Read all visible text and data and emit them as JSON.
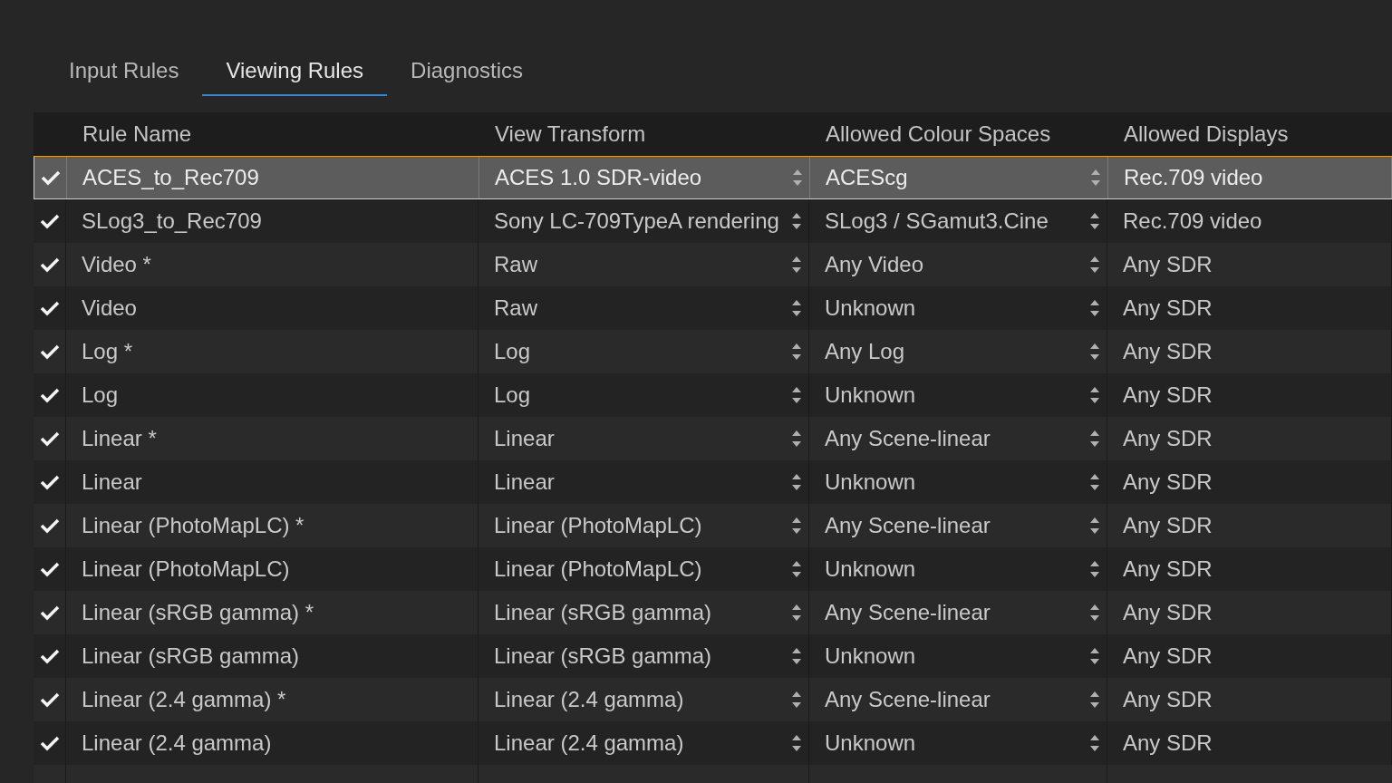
{
  "tabs": [
    {
      "label": "Input Rules",
      "selected": false
    },
    {
      "label": "Viewing Rules",
      "selected": true
    },
    {
      "label": "Diagnostics",
      "selected": false
    }
  ],
  "table": {
    "columns": [
      "Rule Name",
      "View Transform",
      "Allowed Colour Spaces",
      "Allowed Displays"
    ],
    "rows": [
      {
        "checked": true,
        "selected": true,
        "rule_name": "ACES_to_Rec709",
        "view_transform": "ACES 1.0 SDR-video",
        "colour_spaces": "ACEScg",
        "displays": "Rec.709 video"
      },
      {
        "checked": true,
        "selected": false,
        "rule_name": "SLog3_to_Rec709",
        "view_transform": "Sony LC-709TypeA rendering",
        "colour_spaces": "SLog3 / SGamut3.Cine",
        "displays": "Rec.709 video"
      },
      {
        "checked": true,
        "selected": false,
        "rule_name": "Video *",
        "view_transform": "Raw",
        "colour_spaces": "Any Video",
        "displays": "Any SDR"
      },
      {
        "checked": true,
        "selected": false,
        "rule_name": "Video",
        "view_transform": "Raw",
        "colour_spaces": "Unknown",
        "displays": "Any SDR"
      },
      {
        "checked": true,
        "selected": false,
        "rule_name": "Log *",
        "view_transform": "Log",
        "colour_spaces": "Any Log",
        "displays": "Any SDR"
      },
      {
        "checked": true,
        "selected": false,
        "rule_name": "Log",
        "view_transform": "Log",
        "colour_spaces": "Unknown",
        "displays": "Any SDR"
      },
      {
        "checked": true,
        "selected": false,
        "rule_name": "Linear *",
        "view_transform": "Linear",
        "colour_spaces": "Any Scene-linear",
        "displays": "Any SDR"
      },
      {
        "checked": true,
        "selected": false,
        "rule_name": "Linear",
        "view_transform": "Linear",
        "colour_spaces": "Unknown",
        "displays": "Any SDR"
      },
      {
        "checked": true,
        "selected": false,
        "rule_name": "Linear (PhotoMapLC) *",
        "view_transform": "Linear (PhotoMapLC)",
        "colour_spaces": "Any Scene-linear",
        "displays": "Any SDR"
      },
      {
        "checked": true,
        "selected": false,
        "rule_name": "Linear (PhotoMapLC)",
        "view_transform": "Linear (PhotoMapLC)",
        "colour_spaces": "Unknown",
        "displays": "Any SDR"
      },
      {
        "checked": true,
        "selected": false,
        "rule_name": "Linear (sRGB gamma) *",
        "view_transform": "Linear (sRGB gamma)",
        "colour_spaces": "Any Scene-linear",
        "displays": "Any SDR"
      },
      {
        "checked": true,
        "selected": false,
        "rule_name": "Linear (sRGB gamma)",
        "view_transform": "Linear (sRGB gamma)",
        "colour_spaces": "Unknown",
        "displays": "Any SDR"
      },
      {
        "checked": true,
        "selected": false,
        "rule_name": "Linear (2.4 gamma) *",
        "view_transform": "Linear (2.4 gamma)",
        "colour_spaces": "Any Scene-linear",
        "displays": "Any SDR"
      },
      {
        "checked": true,
        "selected": false,
        "rule_name": "Linear (2.4 gamma)",
        "view_transform": "Linear (2.4 gamma)",
        "colour_spaces": "Unknown",
        "displays": "Any SDR"
      }
    ]
  }
}
